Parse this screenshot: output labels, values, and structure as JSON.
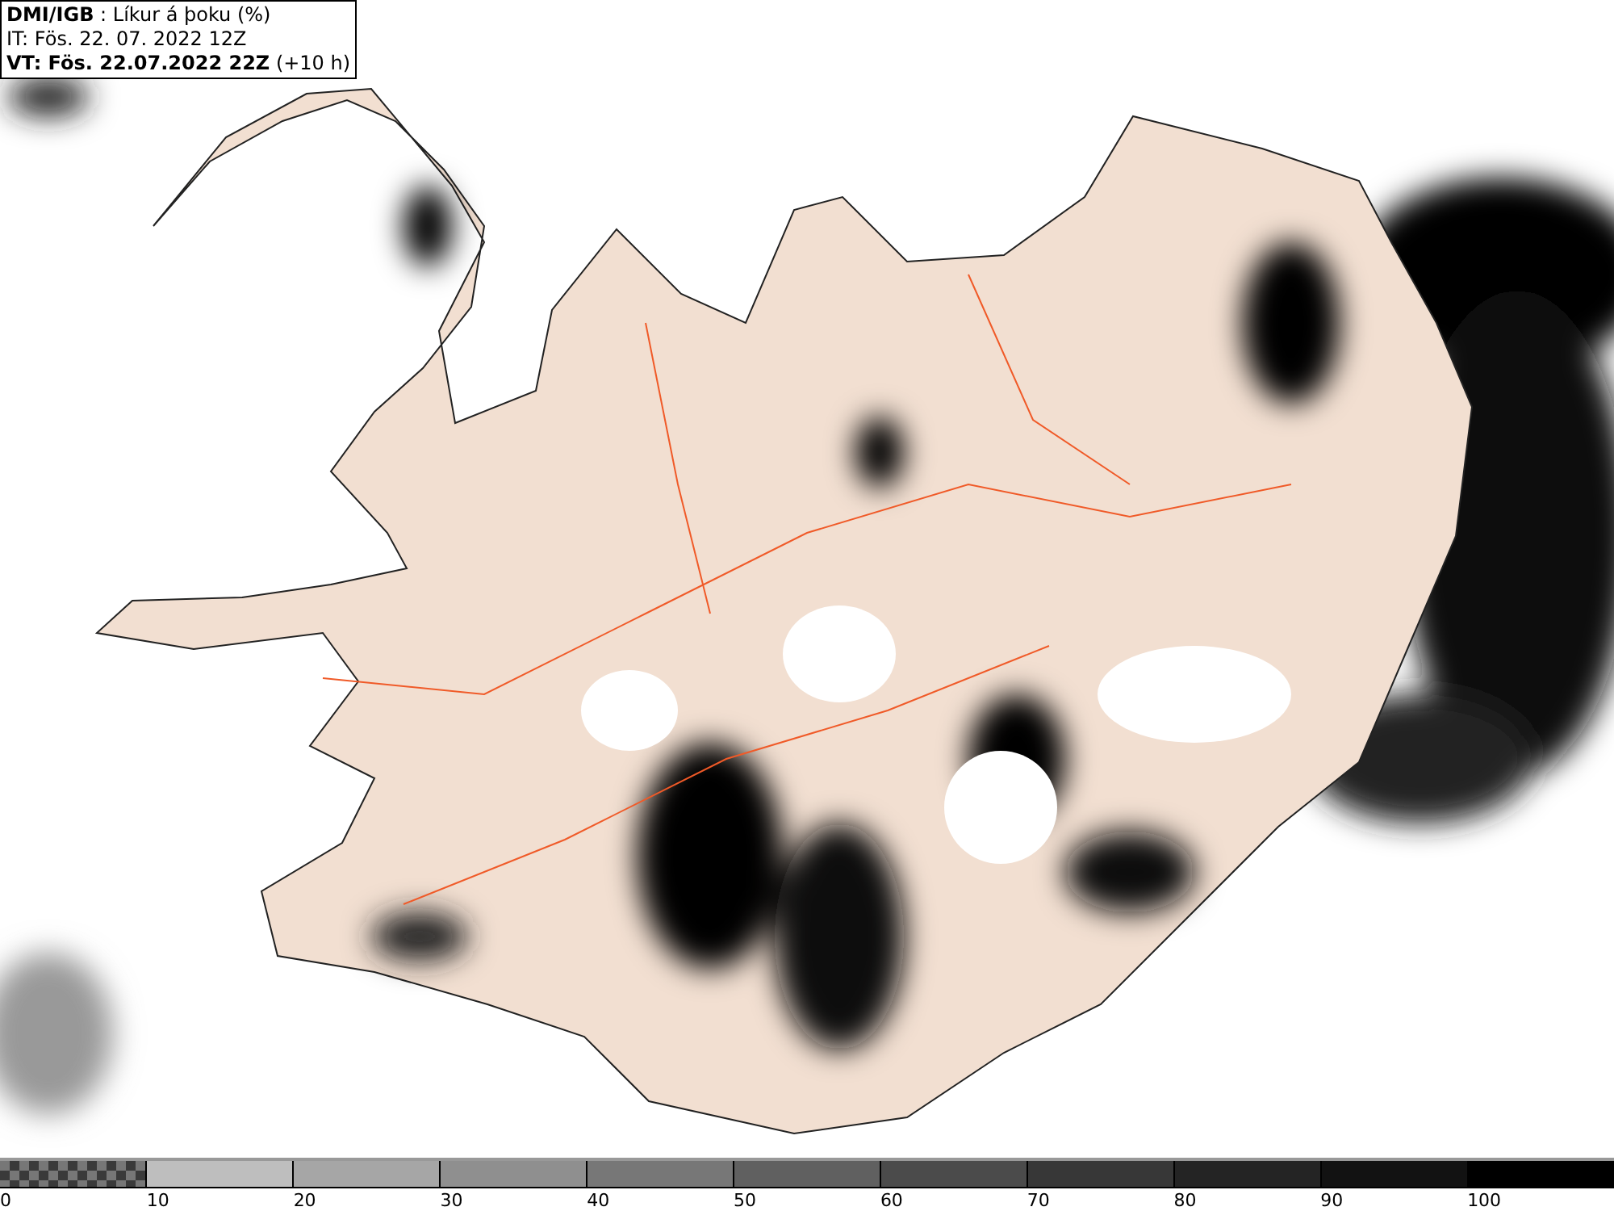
{
  "title_box": {
    "lines": [
      "**DMI/IGB** : Líkur á þoku (%)",
      "IT: Fös. 22. 07. 2022 12Z",
      "**VT: Fös. 22.07.2022 22Z** (+10 h)"
    ]
  },
  "legend": {
    "swatches": [
      {
        "kind": "checker",
        "color": "#3a3a3a"
      },
      {
        "kind": "solid",
        "color": "#bebebe"
      },
      {
        "kind": "solid",
        "color": "#a6a6a6"
      },
      {
        "kind": "solid",
        "color": "#8f8f8f"
      },
      {
        "kind": "solid",
        "color": "#777777"
      },
      {
        "kind": "solid",
        "color": "#606060"
      },
      {
        "kind": "solid",
        "color": "#4b4b4b"
      },
      {
        "kind": "solid",
        "color": "#373737"
      },
      {
        "kind": "solid",
        "color": "#242424"
      },
      {
        "kind": "solid",
        "color": "#121212"
      },
      {
        "kind": "solid",
        "color": "#000000"
      }
    ],
    "ticks": [
      "0",
      "10",
      "20",
      "30",
      "40",
      "50",
      "60",
      "70",
      "80",
      "90",
      "100"
    ]
  }
}
